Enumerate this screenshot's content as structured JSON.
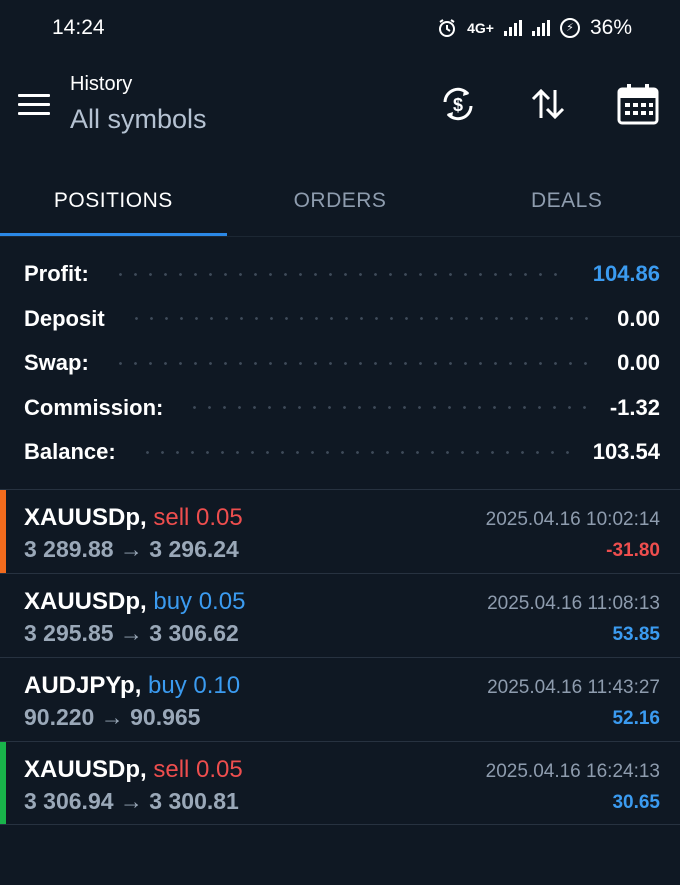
{
  "status_bar": {
    "time": "14:24",
    "network": "4G+",
    "battery": "36%",
    "icons": [
      "alarm-icon",
      "signal-icon",
      "signal-icon",
      "battery-saver-icon"
    ]
  },
  "header": {
    "title": "History",
    "subtitle": "All symbols",
    "actions": [
      "currency-exchange-icon",
      "sort-icon",
      "calendar-icon"
    ]
  },
  "tabs": [
    {
      "label": "POSITIONS",
      "active": true
    },
    {
      "label": "ORDERS",
      "active": false
    },
    {
      "label": "DEALS",
      "active": false
    }
  ],
  "summary": [
    {
      "label": "Profit:",
      "value": "104.86",
      "color": "#3b9bf0"
    },
    {
      "label": "Deposit",
      "value": "0.00",
      "color": "#ffffff"
    },
    {
      "label": "Swap:",
      "value": "0.00",
      "color": "#ffffff"
    },
    {
      "label": "Commission:",
      "value": "-1.32",
      "color": "#ffffff"
    },
    {
      "label": "Balance:",
      "value": "103.54",
      "color": "#ffffff"
    }
  ],
  "positions": [
    {
      "symbol": "XAUUSDp,",
      "side": "sell 0.05",
      "side_color": "#ee4e4e",
      "prices": "3 289.88 → 3 296.24",
      "time": "2025.04.16 10:02:14",
      "profit": "-31.80",
      "profit_color": "#ee4e4e",
      "accent": "#f26b1d"
    },
    {
      "symbol": "XAUUSDp,",
      "side": "buy 0.05",
      "side_color": "#3b9bf0",
      "prices": "3 295.85 → 3 306.62",
      "time": "2025.04.16 11:08:13",
      "profit": "53.85",
      "profit_color": "#3b9bf0",
      "accent": ""
    },
    {
      "symbol": "AUDJPYp,",
      "side": "buy 0.10",
      "side_color": "#3b9bf0",
      "prices": "90.220 → 90.965",
      "time": "2025.04.16 11:43:27",
      "profit": "52.16",
      "profit_color": "#3b9bf0",
      "accent": ""
    },
    {
      "symbol": "XAUUSDp,",
      "side": "sell 0.05",
      "side_color": "#ee4e4e",
      "prices": "3 306.94 → 3 300.81",
      "time": "2025.04.16 16:24:13",
      "profit": "30.65",
      "profit_color": "#3b9bf0",
      "accent": "#19b34a"
    }
  ]
}
